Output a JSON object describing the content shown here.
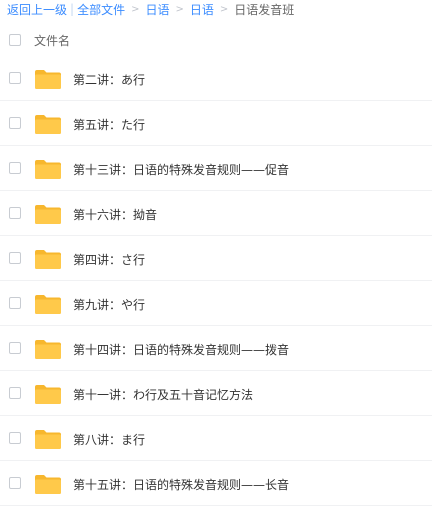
{
  "breadcrumb": {
    "back": "返回上一级",
    "all_files": "全部文件",
    "level1": "日语",
    "level2": "日语",
    "current": "日语发音班"
  },
  "header": {
    "column_name": "文件名"
  },
  "files": [
    {
      "name": "第二讲：あ行"
    },
    {
      "name": "第五讲：た行"
    },
    {
      "name": "第十三讲：日语的特殊发音规则——促音"
    },
    {
      "name": "第十六讲：拗音"
    },
    {
      "name": "第四讲：さ行"
    },
    {
      "name": "第九讲：や行"
    },
    {
      "name": "第十四讲：日语的特殊发音规则——拨音"
    },
    {
      "name": "第十一讲：わ行及五十音记忆方法"
    },
    {
      "name": "第八讲：ま行"
    },
    {
      "name": "第十五讲：日语的特殊发音规则——长音"
    }
  ],
  "colors": {
    "link": "#3b8cff",
    "folder_body": "#ffc94a",
    "folder_tab": "#f7b72e"
  },
  "icons": {
    "folder": "folder-icon",
    "checkbox": "checkbox"
  }
}
